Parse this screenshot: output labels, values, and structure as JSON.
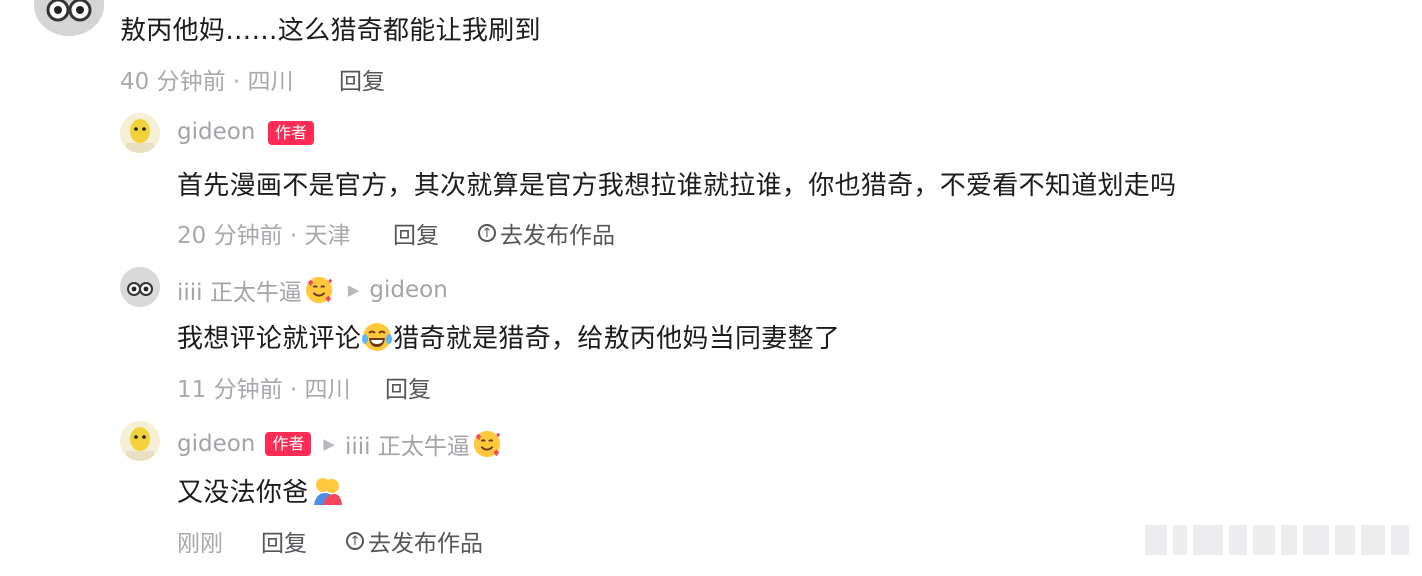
{
  "comment": {
    "text": "敖丙他妈……这么猎奇都能让我刷到",
    "time_location": "40 分钟前 · 四川",
    "reply_label": "回复"
  },
  "replies": [
    {
      "username": "gideon",
      "badge": "作者",
      "text": "首先漫画不是官方，其次就算是官方我想拉谁就拉谁，你也猎奇，不爱看不知道划走吗",
      "time_location": "20 分钟前 · 天津",
      "reply_label": "回复",
      "publish_label": "去发布作品"
    },
    {
      "username": "iiii 正太牛逼",
      "reply_to": "gideon",
      "text_before": "我想评论就评论",
      "text_after": "猎奇就是猎奇，给敖丙他妈当同妻整了",
      "time_location": "11 分钟前 · 四川",
      "reply_label": "回复"
    },
    {
      "username": "gideon",
      "badge": "作者",
      "reply_to": "iiii 正太牛逼",
      "text": "又没法你爸",
      "time_location": "刚刚",
      "reply_label": "回复",
      "publish_label": "去发布作品"
    }
  ],
  "icons": {
    "reply_arrow": "triangle-right-icon",
    "publish": "up-arrow-circle-icon",
    "emoji_love": "smiling-face-with-hearts-emoji",
    "emoji_laugh": "tears-of-joy-emoji",
    "emoji_hug": "people-hugging-emoji"
  },
  "colors": {
    "badge": "#fe2c55",
    "meta": "#a8a8ad",
    "text": "#1c1c1e"
  }
}
